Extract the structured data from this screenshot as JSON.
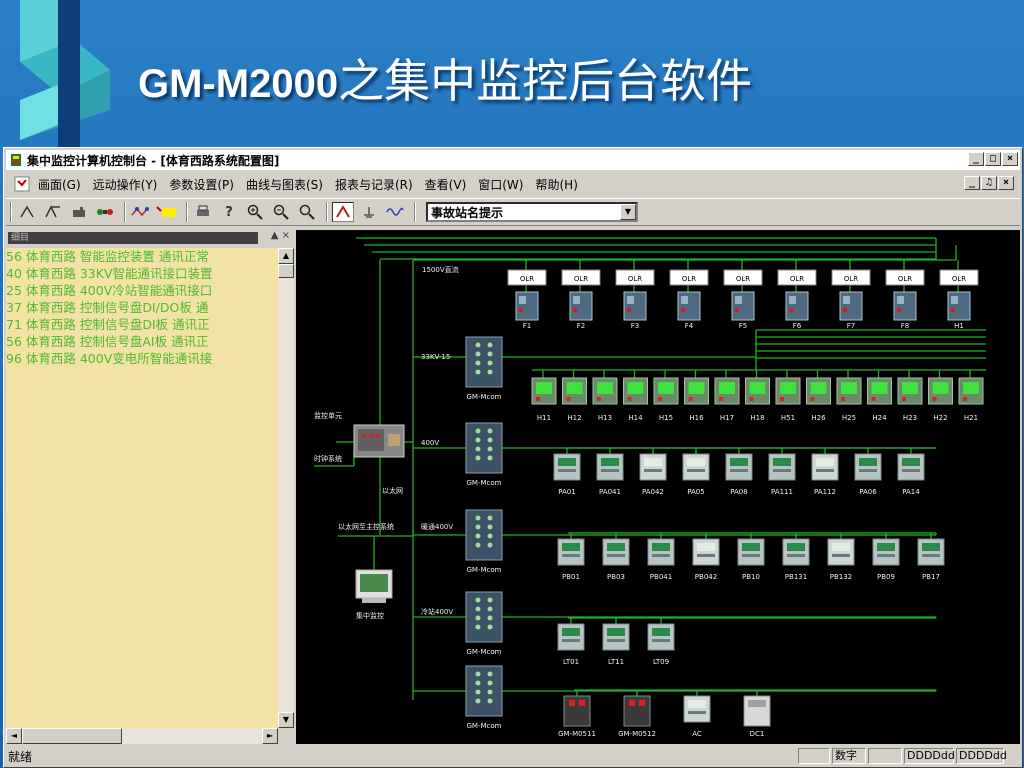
{
  "slide": {
    "title_latin": "GM-M2000",
    "title_cjk": "之集中监控后台软件",
    "accent": "#1f6fb8"
  },
  "window": {
    "title": "集中监控计算机控制台 - [体育西路系统配置图]",
    "min_label": "_",
    "max_label": "□",
    "close_label": "×"
  },
  "menu": {
    "items": [
      "画面(G)",
      "远动操作(Y)",
      "参数设置(P)",
      "曲线与图表(S)",
      "报表与记录(R)",
      "查看(V)",
      "窗口(W)",
      "帮助(H)"
    ],
    "mdi_min": "_",
    "mdi_restore": "♫",
    "mdi_close": "×"
  },
  "toolbar": {
    "station_select_value": "事故站名提示"
  },
  "event_panel": {
    "header": "细目",
    "ctrl": "▲ ×",
    "events": [
      "56 体育西路 智能监控装置 通讯正常",
      "40 体育西路 33KV智能通讯接口装置",
      "25 体育西路 400V冷站智能通讯接口",
      "37 体育西路 控制信号盘DI/DO板 通",
      "71 体育西路 控制信号盘DI板 通讯正",
      "56 体育西路 控制信号盘AI板 通讯正",
      "96 体育西路 400V变电所智能通讯接"
    ]
  },
  "diagram": {
    "colors": {
      "bus": "#22b322",
      "label": "#f0f0f0",
      "bg": "#000000"
    },
    "labels": {
      "bus_1500": "1500V直流",
      "bus_33kv": "33KV-15",
      "bus_400v": "400V",
      "bus_400v_hvac": "暖通400V",
      "bus_400v_cold": "冷站400V",
      "ctrl_unit": "监控单元",
      "clock_sys": "时钟系统",
      "ethernet": "以太网",
      "eth_main": "以太网至主控系统",
      "central": "集中监控",
      "gateway": "GM-Mcom"
    },
    "dc_feeders": [
      "OLR",
      "OLR",
      "OLR",
      "OLR",
      "OLR",
      "OLR",
      "OLR",
      "OLR",
      "OLR"
    ],
    "dc_names": [
      "F1",
      "F2",
      "F3",
      "F4",
      "F5",
      "F6",
      "F7",
      "F8",
      "H1"
    ],
    "hv_units": [
      "H11",
      "H12",
      "H13",
      "H14",
      "H15",
      "H16",
      "H17",
      "H18",
      "H51",
      "H26",
      "H25",
      "H24",
      "H23",
      "H22",
      "H21"
    ],
    "row_400v": [
      "PA01",
      "PA041",
      "PA042",
      "PA05",
      "PA08",
      "PA111",
      "PA112",
      "PA06",
      "PA14"
    ],
    "row_hvac": [
      "PB01",
      "PB03",
      "PB041",
      "PB042",
      "PB10",
      "PB131",
      "PB132",
      "PB09",
      "PB17"
    ],
    "row_cold": [
      "LT01",
      "LT11",
      "LT09"
    ],
    "row_misc": [
      "GM-M0511",
      "GM-M0512",
      "AC",
      "DC1"
    ]
  },
  "status": {
    "ready": "就绪",
    "cell_num": "数字",
    "cell_date1": "DDDDdd",
    "cell_date2": "DDDDdd"
  }
}
